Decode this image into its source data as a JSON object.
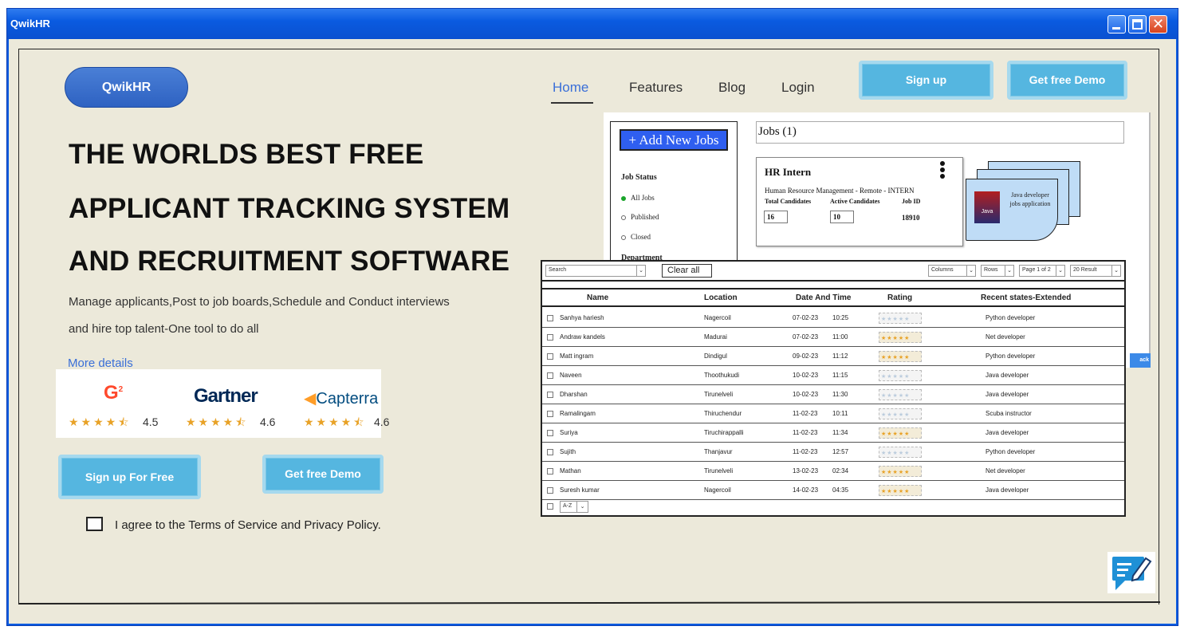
{
  "window": {
    "title": "QwikHR"
  },
  "header": {
    "logo": "QwikHR",
    "nav": [
      "Home",
      "Features",
      "Blog",
      "Login"
    ],
    "signup": "Sign up",
    "demo": "Get free Demo"
  },
  "hero": {
    "lines": [
      "THE WORLDS BEST FREE",
      "APPLICANT TRACKING  SYSTEM",
      "AND RECRUITMENT SOFTWARE"
    ],
    "sub1": "Manage applicants,Post to job boards,Schedule and Conduct interviews",
    "sub2": "and hire top talent-One tool to do all",
    "more": "More details"
  },
  "ratings": [
    {
      "brand": "G2",
      "brand_text": "G",
      "brand_sup": "2",
      "stars": "★★★★⯪",
      "score": "4.5",
      "color": "#ff492c"
    },
    {
      "brand": "Gartner",
      "brand_text": "Gartner",
      "stars": "★★★★⯪",
      "score": "4.6",
      "color": "#002856"
    },
    {
      "brand": "Capterra",
      "brand_text": "Capterra",
      "stars": "★★★★⯪",
      "score": "4.6",
      "color": "#044d80"
    }
  ],
  "actions": {
    "signup_free": "Sign up For Free",
    "demo": "Get free Demo"
  },
  "agree": "I agree to the Terms of Service and Privacy Policy.",
  "dashboard": {
    "add_job": "+ Add New Jobs",
    "job_status": "Job Status",
    "filters": [
      "All Jobs",
      "Published",
      "Closed"
    ],
    "department": "Department",
    "jobs_title": "Jobs (1)",
    "card": {
      "title": "HR Intern",
      "desc": "Human Resource Management - Remote - INTERN",
      "labels": [
        "Total Candidates",
        "Active Candidates",
        "Job ID"
      ],
      "total": "16",
      "active": "10",
      "job_id": "18910"
    },
    "doc": {
      "logo": "Java",
      "line1": "Java developer",
      "line2": "jobs application"
    },
    "tab": "ack"
  },
  "table": {
    "search": "Search",
    "clear": "Clear all",
    "columns": "Columns",
    "rows": "Rows",
    "page": "Page 1 of 2",
    "result": "20 Result",
    "headers": [
      "Name",
      "Location",
      "Date And Time",
      "Rating",
      "Recent states-Extended"
    ],
    "data": [
      {
        "name": "Sanhya hariesh",
        "loc": "Nagercoil",
        "date": "07-02-23",
        "time": "10:25",
        "rating_gold": false,
        "state": "Python developer"
      },
      {
        "name": "Andraw kandels",
        "loc": "Madurai",
        "date": "07-02-23",
        "time": "11:00",
        "rating_gold": true,
        "state": "Net developer"
      },
      {
        "name": "Matt ingram",
        "loc": "Dindigul",
        "date": "09-02-23",
        "time": "11:12",
        "rating_gold": true,
        "state": "Python developer"
      },
      {
        "name": "Naveen",
        "loc": "Thoothukudi",
        "date": "10-02-23",
        "time": "11:15",
        "rating_gold": false,
        "state": "Java developer"
      },
      {
        "name": "Dharshan",
        "loc": "Tirunelveli",
        "date": "10-02-23",
        "time": "11:30",
        "rating_gold": false,
        "state": "Java developer"
      },
      {
        "name": "Ramalingam",
        "loc": "Thiruchendur",
        "date": "11-02-23",
        "time": "10:11",
        "rating_gold": false,
        "state": "Scuba instructor"
      },
      {
        "name": "Suriya",
        "loc": "Tiruchirappalli",
        "date": "11-02-23",
        "time": "11:34",
        "rating_gold": true,
        "state": "Java developer"
      },
      {
        "name": "Sujith",
        "loc": "Thanjavur",
        "date": "11-02-23",
        "time": "12:57",
        "rating_gold": false,
        "state": "Python developer"
      },
      {
        "name": "Mathan",
        "loc": "Tirunelveli",
        "date": "13-02-23",
        "time": "02:34",
        "rating_gold": true,
        "state": "Net developer"
      },
      {
        "name": "Suresh kumar",
        "loc": "Nagercoil",
        "date": "14-02-23",
        "time": "04:35",
        "rating_gold": true,
        "state": "Java developer"
      }
    ],
    "sort": "A-Z",
    "stars": "★★★★★"
  },
  "icons": {
    "chat": "chat-edit-icon",
    "minimize": "minimize-icon",
    "maximize": "maximize-icon",
    "close": "close-icon"
  }
}
